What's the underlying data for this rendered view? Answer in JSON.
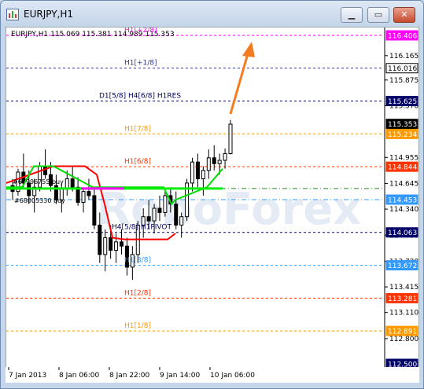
{
  "window": {
    "title": "EURJPY,H1",
    "buttons": {
      "minimize": "▁",
      "maximize": "▭",
      "close": "✕"
    }
  },
  "chart_header": "EURJPY,H1  115.069 115.381 114.989 115.353",
  "annotations": {
    "order_1": "#67996755 buy",
    "order_2": "#68005330 buy"
  },
  "level_labels": [
    {
      "text": "H1[+2/8]",
      "price": 116.406,
      "color": "#ff00ff"
    },
    {
      "text": "H1[+1/8]",
      "price": 116.016,
      "color": "#333399"
    },
    {
      "text": "D1[5/8] H4[6/8] H1RES",
      "price": 115.625,
      "color": "#000066"
    },
    {
      "text": "H1[7/8]",
      "price": 115.234,
      "color": "#ff9900"
    },
    {
      "text": "H1[6/8]",
      "price": 114.844,
      "color": "#ff3300"
    },
    {
      "text": "H4[5/8] H1PIVOT",
      "price": 114.063,
      "color": "#000066"
    },
    {
      "text": "H1[3/8]",
      "price": 113.672,
      "color": "#3399ff"
    },
    {
      "text": "H1[2/8]",
      "price": 113.281,
      "color": "#ff3300"
    },
    {
      "text": "H1[1/8]",
      "price": 112.891,
      "color": "#ff9900"
    }
  ],
  "price_axis": {
    "labels": [
      "116.165",
      "115.875",
      "115.570",
      "114.955",
      "114.645",
      "114.340",
      "114.030",
      "113.720",
      "113.415",
      "113.110",
      "112.800"
    ],
    "label_prices": [
      116.165,
      115.875,
      115.57,
      114.955,
      114.645,
      114.34,
      114.03,
      113.72,
      113.415,
      113.11,
      112.8
    ],
    "badges": [
      {
        "text": "116.406",
        "price": 116.406,
        "bg": "#ff00ff",
        "fg": "#ffffff"
      },
      {
        "text": "116.016",
        "price": 116.016,
        "bg": "#ffffff",
        "fg": "#000000"
      },
      {
        "text": "115.625",
        "price": 115.625,
        "bg": "#000066",
        "fg": "#ffffff"
      },
      {
        "text": "115.353",
        "price": 115.353,
        "bg": "#000000",
        "fg": "#ffffff"
      },
      {
        "text": "115.234",
        "price": 115.234,
        "bg": "#ff9900",
        "fg": "#ffffff"
      },
      {
        "text": "114.844",
        "price": 114.844,
        "bg": "#ff3300",
        "fg": "#ffffff"
      },
      {
        "text": "114.453",
        "price": 114.453,
        "bg": "#3399ff",
        "fg": "#ffffff"
      },
      {
        "text": "114.063",
        "price": 114.063,
        "bg": "#000066",
        "fg": "#ffffff"
      },
      {
        "text": "113.672",
        "price": 113.672,
        "bg": "#3399ff",
        "fg": "#ffffff"
      },
      {
        "text": "113.281",
        "price": 113.281,
        "bg": "#ff3300",
        "fg": "#ffffff"
      },
      {
        "text": "112.891",
        "price": 112.891,
        "bg": "#ff9900",
        "fg": "#ffffff"
      },
      {
        "text": "112.500",
        "price": 112.5,
        "bg": "#000066",
        "fg": "#ffffff"
      }
    ]
  },
  "time_axis": [
    "7 Jan 2013",
    "8 Jan 06:00",
    "8 Jan 22:00",
    "9 Jan 14:00",
    "10 Jan 06:00"
  ],
  "watermark": "RoboForex",
  "chart_data": {
    "type": "candlestick",
    "symbol": "EURJPY",
    "timeframe": "H1",
    "price_range": [
      112.5,
      116.406
    ],
    "current_price": 115.353,
    "ohlc": [
      [
        114.62,
        114.7,
        114.45,
        114.55
      ],
      [
        114.55,
        114.82,
        114.5,
        114.78
      ],
      [
        114.78,
        115.0,
        114.6,
        114.65
      ],
      [
        114.65,
        114.8,
        114.4,
        114.5
      ],
      [
        114.5,
        114.7,
        114.3,
        114.6
      ],
      [
        114.6,
        114.9,
        114.55,
        114.85
      ],
      [
        114.85,
        115.05,
        114.7,
        114.75
      ],
      [
        114.75,
        114.9,
        114.55,
        114.62
      ],
      [
        114.62,
        114.75,
        114.4,
        114.45
      ],
      [
        114.45,
        114.65,
        114.3,
        114.58
      ],
      [
        114.58,
        114.8,
        114.5,
        114.7
      ],
      [
        114.7,
        114.85,
        114.55,
        114.6
      ],
      [
        114.6,
        114.72,
        114.38,
        114.42
      ],
      [
        114.42,
        114.6,
        114.3,
        114.55
      ],
      [
        114.55,
        114.7,
        114.45,
        114.5
      ],
      [
        114.5,
        114.6,
        114.1,
        114.15
      ],
      [
        114.15,
        114.3,
        113.7,
        113.8
      ],
      [
        113.8,
        114.1,
        113.6,
        114.0
      ],
      [
        114.0,
        114.15,
        113.75,
        113.85
      ],
      [
        113.85,
        114.05,
        113.7,
        113.95
      ],
      [
        113.95,
        114.1,
        113.8,
        113.9
      ],
      [
        113.9,
        114.0,
        113.55,
        113.65
      ],
      [
        113.65,
        113.9,
        113.5,
        113.8
      ],
      [
        113.8,
        114.2,
        113.7,
        114.15
      ],
      [
        114.15,
        114.35,
        114.0,
        114.25
      ],
      [
        114.25,
        114.45,
        114.1,
        114.2
      ],
      [
        114.2,
        114.4,
        114.05,
        114.35
      ],
      [
        114.35,
        114.5,
        114.2,
        114.3
      ],
      [
        114.3,
        114.55,
        114.25,
        114.5
      ],
      [
        114.5,
        114.6,
        114.3,
        114.4
      ],
      [
        114.4,
        114.55,
        114.1,
        114.15
      ],
      [
        114.15,
        114.3,
        114.0,
        114.25
      ],
      [
        114.25,
        114.7,
        114.2,
        114.65
      ],
      [
        114.65,
        114.95,
        114.55,
        114.9
      ],
      [
        114.9,
        115.0,
        114.6,
        114.7
      ],
      [
        114.7,
        114.85,
        114.5,
        114.8
      ],
      [
        114.8,
        115.05,
        114.7,
        114.95
      ],
      [
        114.95,
        115.1,
        114.8,
        114.88
      ],
      [
        114.88,
        115.0,
        114.75,
        114.92
      ],
      [
        114.92,
        115.06,
        114.82,
        115.0
      ],
      [
        115.0,
        115.4,
        114.99,
        115.35
      ]
    ]
  }
}
